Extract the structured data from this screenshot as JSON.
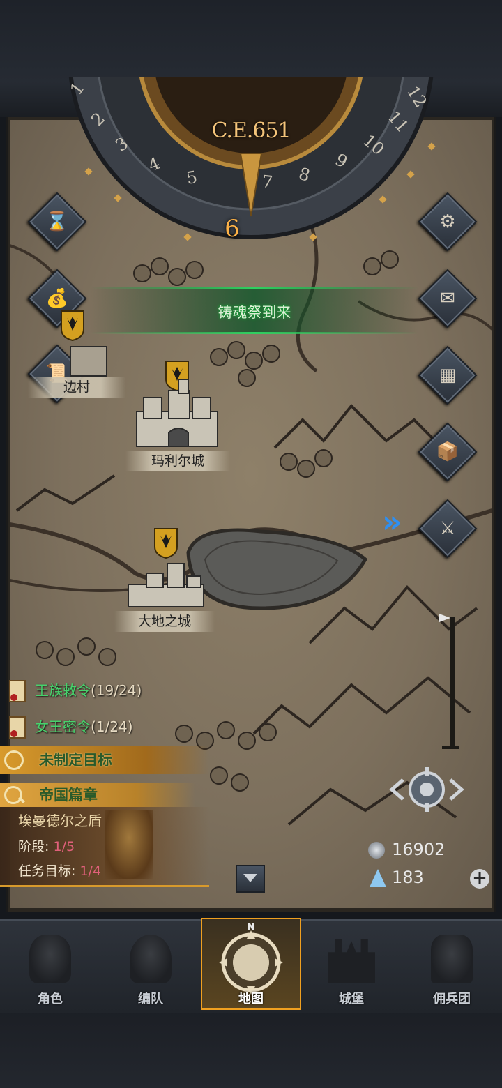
{
  "calendar": {
    "year": "C.E.651",
    "months": [
      "1",
      "2",
      "3",
      "4",
      "5",
      "6",
      "7",
      "8",
      "9",
      "10",
      "11",
      "12"
    ],
    "current_month": "6"
  },
  "event_banner": {
    "text": "铸魂祭到来"
  },
  "cities": [
    {
      "name": "边村"
    },
    {
      "name": "玛利尔城"
    },
    {
      "name": "大地之城"
    }
  ],
  "quests": [
    {
      "name": "王族敕令",
      "count": "(19/24)"
    },
    {
      "name": "女王密令",
      "count": "(1/24)"
    }
  ],
  "goal": {
    "label": "未制定目标"
  },
  "chapter": {
    "header": "帝国篇章",
    "title": "埃曼德尔之盾",
    "stage_label": "阶段:",
    "stage_value": "1/5",
    "target_label": "任务目标:",
    "target_value": "1/4"
  },
  "resources": {
    "silver": "16902",
    "crystal": "183"
  },
  "compass_letter": "N",
  "nav": [
    {
      "label": "角色"
    },
    {
      "label": "编队"
    },
    {
      "label": "地图"
    },
    {
      "label": "城堡"
    },
    {
      "label": "佣兵团"
    }
  ],
  "icons": {
    "left": [
      "hourglass-icon",
      "money-bag-icon",
      "scroll-icon"
    ],
    "right": [
      "gear-icon",
      "mail-icon",
      "board-icon",
      "supplies-icon",
      "knight-icon"
    ]
  },
  "colors": {
    "accent": "#f0a020",
    "quest_green": "#47d26c",
    "banner_green": "#2fd060"
  }
}
